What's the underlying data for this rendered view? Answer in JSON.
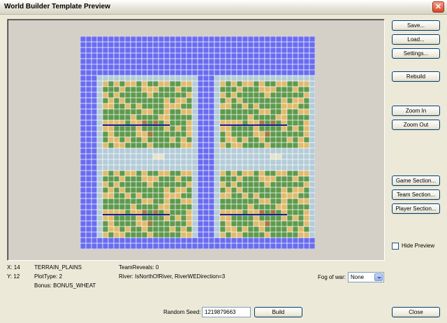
{
  "window": {
    "title": "World Builder Template Preview",
    "close_glyph": "✕"
  },
  "buttons": {
    "save": "Save...",
    "load": "Load...",
    "settings": "Settings...",
    "rebuild": "Rebuild",
    "zoom_in": "Zoom In",
    "zoom_out": "Zoom Out",
    "game_section": "Game Section...",
    "team_section": "Team Section...",
    "player_section": "Player Section...",
    "build": "Build",
    "close": "Close"
  },
  "hide_preview": {
    "label": "Hide Preview",
    "checked": false
  },
  "info": {
    "x": "X: 14",
    "y": "Y: 12",
    "terrain": "TERRAIN_PLAINS",
    "plot_type": "PlotType: 2",
    "bonus": "Bonus: BONUS_WHEAT",
    "team_reveals": "TeamReveals: 0",
    "river": "River: IsNorthOfRiver, RiverWEDirection=3"
  },
  "fog": {
    "label": "Fog of war:",
    "selected": "None"
  },
  "seed": {
    "label": "Random Seed:",
    "value": "1219879663"
  },
  "map": {
    "cols": 42,
    "rows": 38,
    "colors": {
      "ocean": "#6a6cf0",
      "coast": "#b4ccd8",
      "grass": "#5e9a4e",
      "plains": "#e0bb6c",
      "hills": "#a27a42",
      "peak": "#e6e2c8",
      "river": "#1a1a9a",
      "grid": "#ffffff"
    }
  }
}
